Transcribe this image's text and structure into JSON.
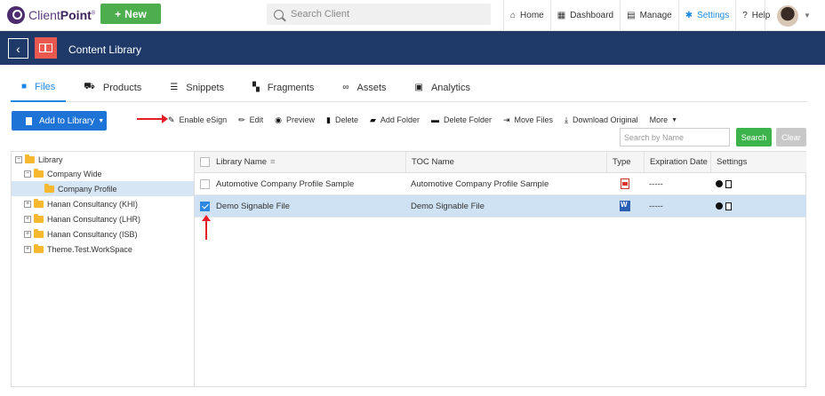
{
  "brand": {
    "name_light": "Client",
    "name_bold": "Point",
    "trademark": "®"
  },
  "new_button": {
    "icon": "plus-icon",
    "label": "New"
  },
  "search_client": {
    "placeholder": "Search Client"
  },
  "nav": [
    {
      "icon": "home-icon",
      "label": "Home"
    },
    {
      "icon": "dashboard-icon",
      "label": "Dashboard"
    },
    {
      "icon": "manage-icon",
      "label": "Manage"
    },
    {
      "icon": "gear-icon",
      "label": "Settings",
      "active": true
    },
    {
      "icon": "help-icon",
      "label": "Help",
      "glyph": "?"
    }
  ],
  "titlebar": {
    "title": "Content Library"
  },
  "tabs": [
    {
      "icon": "file-icon",
      "label": "Files",
      "active": true
    },
    {
      "icon": "basket-icon",
      "label": "Products"
    },
    {
      "icon": "snippets-icon",
      "label": "Snippets"
    },
    {
      "icon": "fragments-icon",
      "label": "Fragments"
    },
    {
      "icon": "link-icon",
      "label": "Assets"
    },
    {
      "icon": "analytics-icon",
      "label": "Analytics"
    }
  ],
  "add_library": {
    "label": "Add to Library"
  },
  "toolbar": [
    {
      "icon": "pen-icon",
      "label": "Enable eSign"
    },
    {
      "icon": "pencil-icon",
      "label": "Edit"
    },
    {
      "icon": "eye-icon",
      "label": "Preview"
    },
    {
      "icon": "trash-icon",
      "label": "Delete"
    },
    {
      "icon": "add-folder-icon",
      "label": "Add Folder"
    },
    {
      "icon": "folder-icon",
      "label": "Delete Folder"
    },
    {
      "icon": "move-icon",
      "label": "Move Files"
    },
    {
      "icon": "download-icon",
      "label": "Download Original"
    },
    {
      "icon": "caret-down-icon",
      "label": "More"
    }
  ],
  "search_name": {
    "placeholder": "Search by Name",
    "search_label": "Search",
    "clear_label": "Clear"
  },
  "tree": [
    {
      "label": "Library",
      "toggle": "−"
    },
    {
      "label": "Company Wide",
      "toggle": "−"
    },
    {
      "label": "Company Profile",
      "selected": true
    },
    {
      "label": "Hanan Consultancy (KHI)",
      "toggle": "+"
    },
    {
      "label": "Hanan Consultancy (LHR)",
      "toggle": "+"
    },
    {
      "label": "Hanan Consultancy (ISB)",
      "toggle": "+"
    },
    {
      "label": "Theme.Test.WorkSpace",
      "toggle": "+"
    }
  ],
  "grid": {
    "columns": [
      "Library Name",
      "TOC Name",
      "Type",
      "Expiration Date",
      "Settings"
    ],
    "sort_indicator": "≡",
    "rows": [
      {
        "name": "Automotive Company Profile Sample",
        "toc": "Automotive Company Profile Sample",
        "type": "pdf-icon",
        "expiration": "-----",
        "checked": false
      },
      {
        "name": "Demo Signable File",
        "toc": "Demo Signable File",
        "type": "word-icon",
        "expiration": "-----",
        "checked": true
      }
    ]
  },
  "colors": {
    "accent": "#1e88e5",
    "titlebar": "#1f3a68",
    "new_button": "#4cae4c",
    "annotation": "#e31e24"
  }
}
